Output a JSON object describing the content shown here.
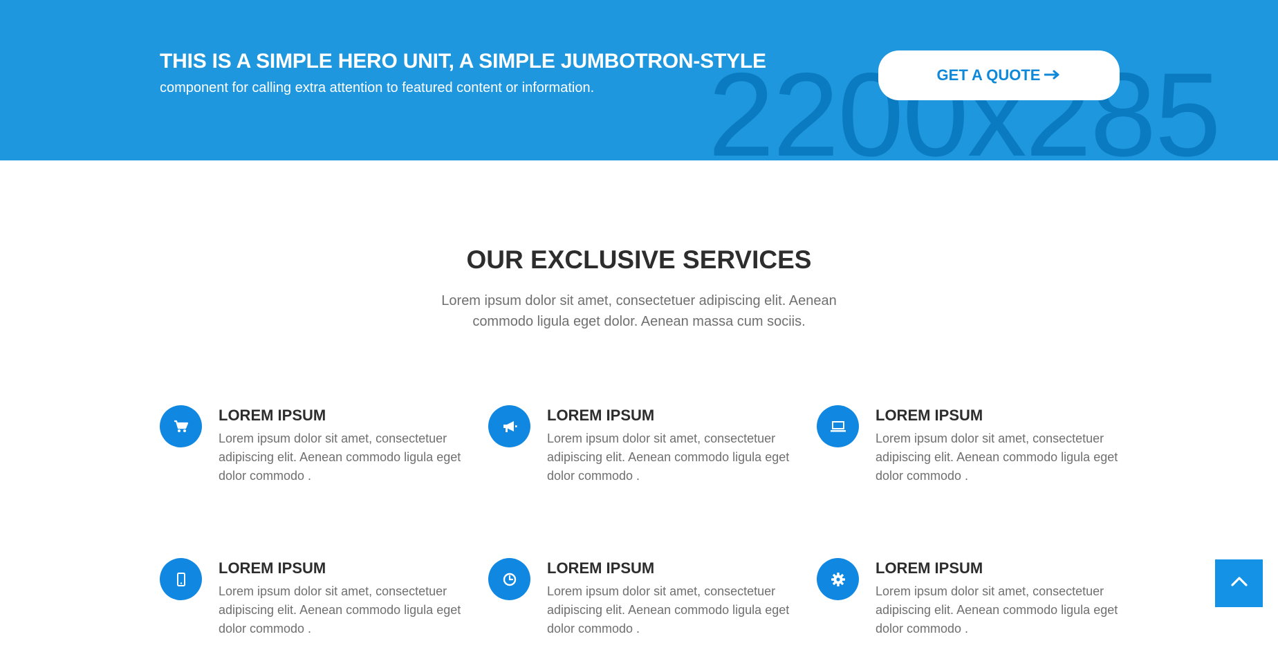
{
  "hero": {
    "watermark": "2200x285",
    "title": "THIS IS A SIMPLE HERO UNIT, A SIMPLE JUMBOTRON-STYLE",
    "subtitle": "component for calling extra attention to featured content or information.",
    "quote_button_label": "GET A QUOTE",
    "quote_button_icon": "arrow-right-icon",
    "background_color": "#1e97de",
    "accent_color": "#1087e1"
  },
  "services": {
    "title": "OUR EXCLUSIVE SERVICES",
    "description": "Lorem ipsum dolor sit amet, consectetuer adipiscing elit. Aenean commodo ligula eget dolor. Aenean massa cum sociis.",
    "items": [
      {
        "icon": "shopping-cart-icon",
        "title": "LOREM IPSUM",
        "text": "Lorem ipsum dolor sit amet, consectetuer adipiscing elit. Aenean commodo ligula eget dolor commodo ."
      },
      {
        "icon": "megaphone-icon",
        "title": "LOREM IPSUM",
        "text": "Lorem ipsum dolor sit amet, consectetuer adipiscing elit. Aenean commodo ligula eget dolor commodo ."
      },
      {
        "icon": "laptop-icon",
        "title": "LOREM IPSUM",
        "text": "Lorem ipsum dolor sit amet, consectetuer adipiscing elit. Aenean commodo ligula eget dolor commodo ."
      },
      {
        "icon": "mobile-phone-icon",
        "title": "LOREM IPSUM",
        "text": "Lorem ipsum dolor sit amet, consectetuer adipiscing elit. Aenean commodo ligula eget dolor commodo ."
      },
      {
        "icon": "clock-icon",
        "title": "LOREM IPSUM",
        "text": "Lorem ipsum dolor sit amet, consectetuer adipiscing elit. Aenean commodo ligula eget dolor commodo ."
      },
      {
        "icon": "gear-icon",
        "title": "LOREM IPSUM",
        "text": "Lorem ipsum dolor sit amet, consectetuer adipiscing elit. Aenean commodo ligula eget dolor commodo ."
      }
    ]
  },
  "back_to_top": {
    "icon": "chevron-up-icon"
  }
}
